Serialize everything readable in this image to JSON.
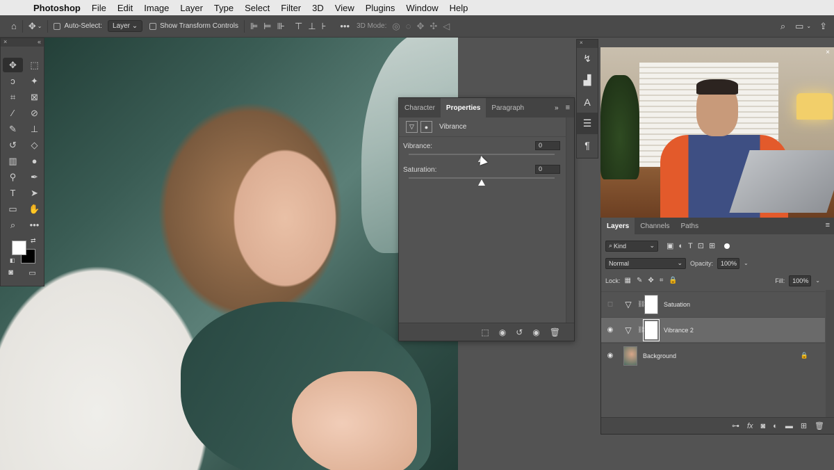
{
  "menubar": {
    "app": "Photoshop",
    "items": [
      "File",
      "Edit",
      "Image",
      "Layer",
      "Type",
      "Select",
      "Filter",
      "3D",
      "View",
      "Plugins",
      "Window",
      "Help"
    ]
  },
  "options": {
    "auto_select": "Auto-Select:",
    "auto_select_value": "Layer",
    "transform": "Show Transform Controls",
    "mode3d": "3D Mode:"
  },
  "properties": {
    "tabs": [
      "Character",
      "Properties",
      "Paragraph"
    ],
    "adjustment": "Vibrance",
    "vibrance_label": "Vibrance:",
    "vibrance_value": "0",
    "vibrance_level": 0.5,
    "saturation_label": "Saturation:",
    "saturation_value": "0",
    "saturation_level": 0.5
  },
  "layers": {
    "tabs": [
      "Layers",
      "Channels",
      "Paths"
    ],
    "kind": "Kind",
    "blend": "Normal",
    "opacity_label": "Opacity:",
    "opacity": "100%",
    "lock_label": "Lock:",
    "fill_label": "Fill:",
    "fill": "100%",
    "items": [
      {
        "name": "Satuation",
        "visible": false
      },
      {
        "name": "Vibrance 2",
        "visible": true,
        "selected": true
      },
      {
        "name": "Background",
        "visible": true,
        "locked": true
      }
    ]
  },
  "colors": {
    "foreground": "#ffffff",
    "background": "#000000",
    "panel": "#535353"
  }
}
